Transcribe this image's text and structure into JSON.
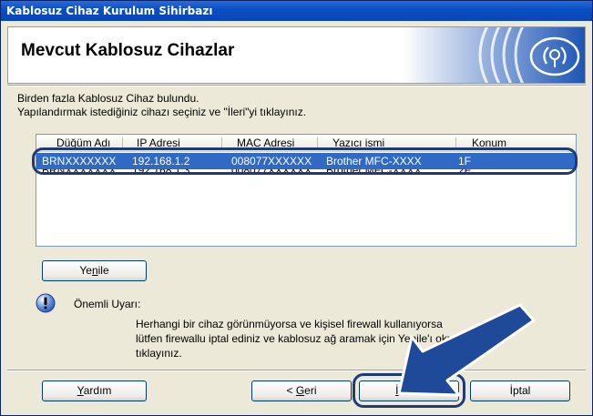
{
  "window": {
    "title": "Kablosuz Cihaz Kurulum Sihirbazı"
  },
  "banner": {
    "title": "Mevcut Kablosuz Cihazlar",
    "logo_icon": "wireless-signal-icon"
  },
  "instructions": {
    "line1": "Birden fazla Kablosuz Cihaz bulundu.",
    "line2": "Yapılandırmak istediğiniz cihazı seçiniz ve \"İleri\"yi tıklayınız."
  },
  "device_list": {
    "columns": [
      "Düğüm Adı",
      "IP Adresi",
      "MAC Adresi",
      "Yazıcı ismi",
      "Konum"
    ],
    "rows": [
      {
        "node": "BRNXXXXXXX",
        "ip": "192.168.1.2",
        "mac": "008077XXXXXX",
        "printer": "Brother MFC-XXXX",
        "location": "1F",
        "selected": true
      },
      {
        "node": "BRNXXXXXXX",
        "ip": "192.168.1.3",
        "mac": "008077XXXXXX",
        "printer": "Brother MFC-XXXX",
        "location": "2F",
        "selected": false
      }
    ]
  },
  "buttons": {
    "refresh": {
      "pre": "Ye",
      "accel": "n",
      "post": "ile"
    },
    "help": {
      "pre": "",
      "accel": "Y",
      "post": "ardım"
    },
    "back": {
      "pre": "< ",
      "accel": "G",
      "post": "eri"
    },
    "next": {
      "pre": "",
      "accel": "İ",
      "post": "leri >"
    },
    "cancel": {
      "pre": "İptal",
      "accel": "",
      "post": ""
    }
  },
  "warning": {
    "icon": "exclamation-info-icon",
    "title": "Önemli Uyarı:",
    "line1": "Herhangi bir cihaz görünmüyorsa ve kişisel firewall kullanıyorsa",
    "line2": "lütfen firewallu iptal ediniz ve kablosuz ağ aramak için Yenile'ı okuşunu",
    "line3": "tıklayınız."
  },
  "colors": {
    "accent": "#316ac5",
    "annotation": "#1f4a99",
    "titlebar": "#0b4fc4"
  }
}
